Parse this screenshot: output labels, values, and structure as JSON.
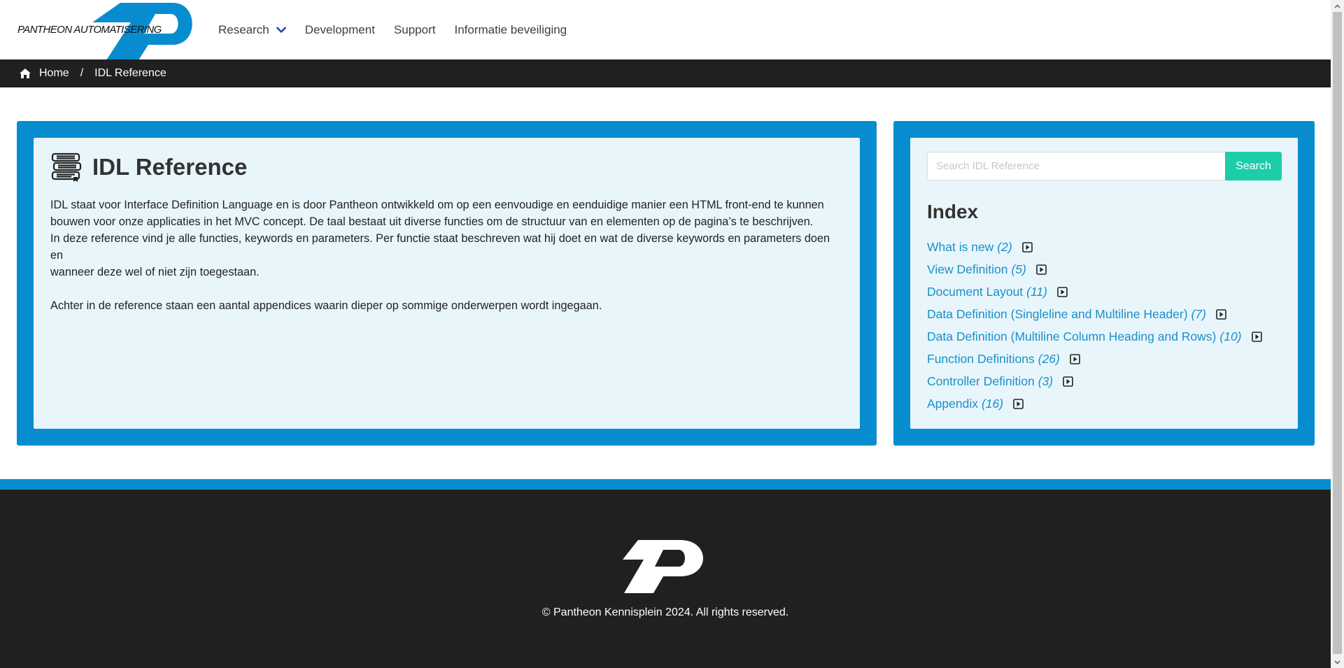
{
  "header": {
    "logo_text": "PANTHEON AUTOMATISERING",
    "nav": [
      {
        "label": "Research",
        "has_dropdown": true
      },
      {
        "label": "Development"
      },
      {
        "label": "Support"
      },
      {
        "label": "Informatie beveiliging"
      }
    ]
  },
  "breadcrumb": {
    "home": "Home",
    "separator": "/",
    "current": "IDL Reference"
  },
  "main": {
    "title": "IDL Reference",
    "paragraph1_line1": "IDL staat voor Interface Definition Language en is door Pantheon ontwikkeld om op een eenvoudige en eenduidige manier een HTML front-end te kunnen",
    "paragraph1_line2": "bouwen voor onze applicaties in het MVC concept. De taal bestaat uit diverse functies om de structuur van en elementen op de pagina’s te beschrijven.",
    "paragraph1_line3": "In deze reference vind je alle functies, keywords en parameters. Per functie staat beschreven wat hij doet en wat de diverse keywords en parameters doen en",
    "paragraph1_line4": "wanneer deze wel of niet zijn toegestaan.",
    "paragraph2": "Achter in de reference staan een aantal appendices waarin dieper op sommige onderwerpen wordt ingegaan."
  },
  "sidebar": {
    "search_placeholder": "Search IDL Reference",
    "search_value": "",
    "search_button": "Search",
    "index_title": "Index",
    "items": [
      {
        "label": "What is new",
        "count": "(2)"
      },
      {
        "label": "View Definition",
        "count": "(5)"
      },
      {
        "label": "Document Layout",
        "count": "(11)"
      },
      {
        "label": "Data Definition (Singleline and Multiline Header)",
        "count": "(7)"
      },
      {
        "label": "Data Definition (Multiline Column Heading and Rows)",
        "count": "(10)"
      },
      {
        "label": "Function Definitions",
        "count": "(26)"
      },
      {
        "label": "Controller Definition",
        "count": "(3)"
      },
      {
        "label": "Appendix",
        "count": "(16)"
      }
    ]
  },
  "footer": {
    "copyright": "© Pantheon Kennisplein 2024. All rights reserved."
  },
  "colors": {
    "brand_blue": "#078dcf",
    "dark": "#221f1f",
    "card_bg": "#e8f6fc",
    "link": "#1a8fc7",
    "search_button": "#1ccda9"
  }
}
